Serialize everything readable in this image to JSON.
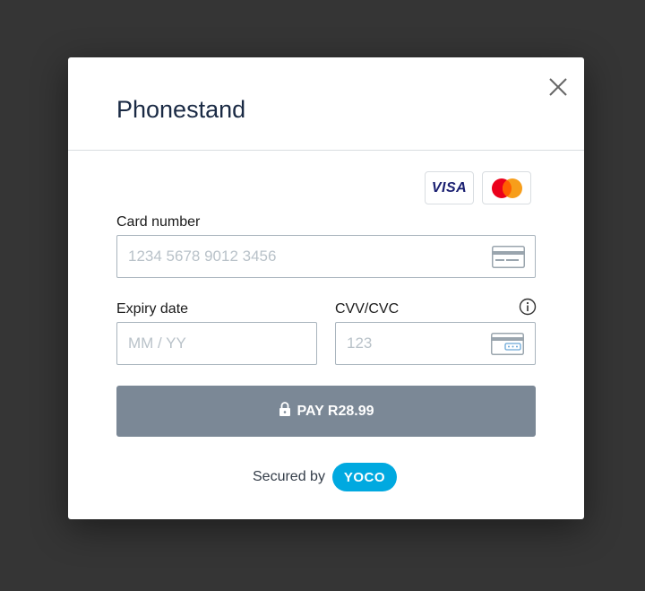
{
  "modal": {
    "title": "Phonestand"
  },
  "card_brands": [
    {
      "name": "VISA",
      "icon": "visa-logo"
    },
    {
      "name": "Mastercard",
      "icon": "mastercard-logo"
    }
  ],
  "form": {
    "card_number": {
      "label": "Card number",
      "placeholder": "1234 5678 9012 3456",
      "value": ""
    },
    "expiry": {
      "label": "Expiry date",
      "placeholder": "MM / YY",
      "value": ""
    },
    "cvv": {
      "label": "CVV/CVC",
      "placeholder": "123",
      "value": "",
      "info_icon": "info-icon"
    }
  },
  "pay_button": {
    "label": "PAY R28.99",
    "icon": "lock-icon"
  },
  "footer": {
    "secured_text": "Secured by",
    "brand": "YOCO"
  },
  "colors": {
    "backdrop": "#353535",
    "title": "#1a2a44",
    "pay_button": "#7b8896",
    "yoco": "#00a9e0",
    "input_border": "#a9b4bd"
  }
}
